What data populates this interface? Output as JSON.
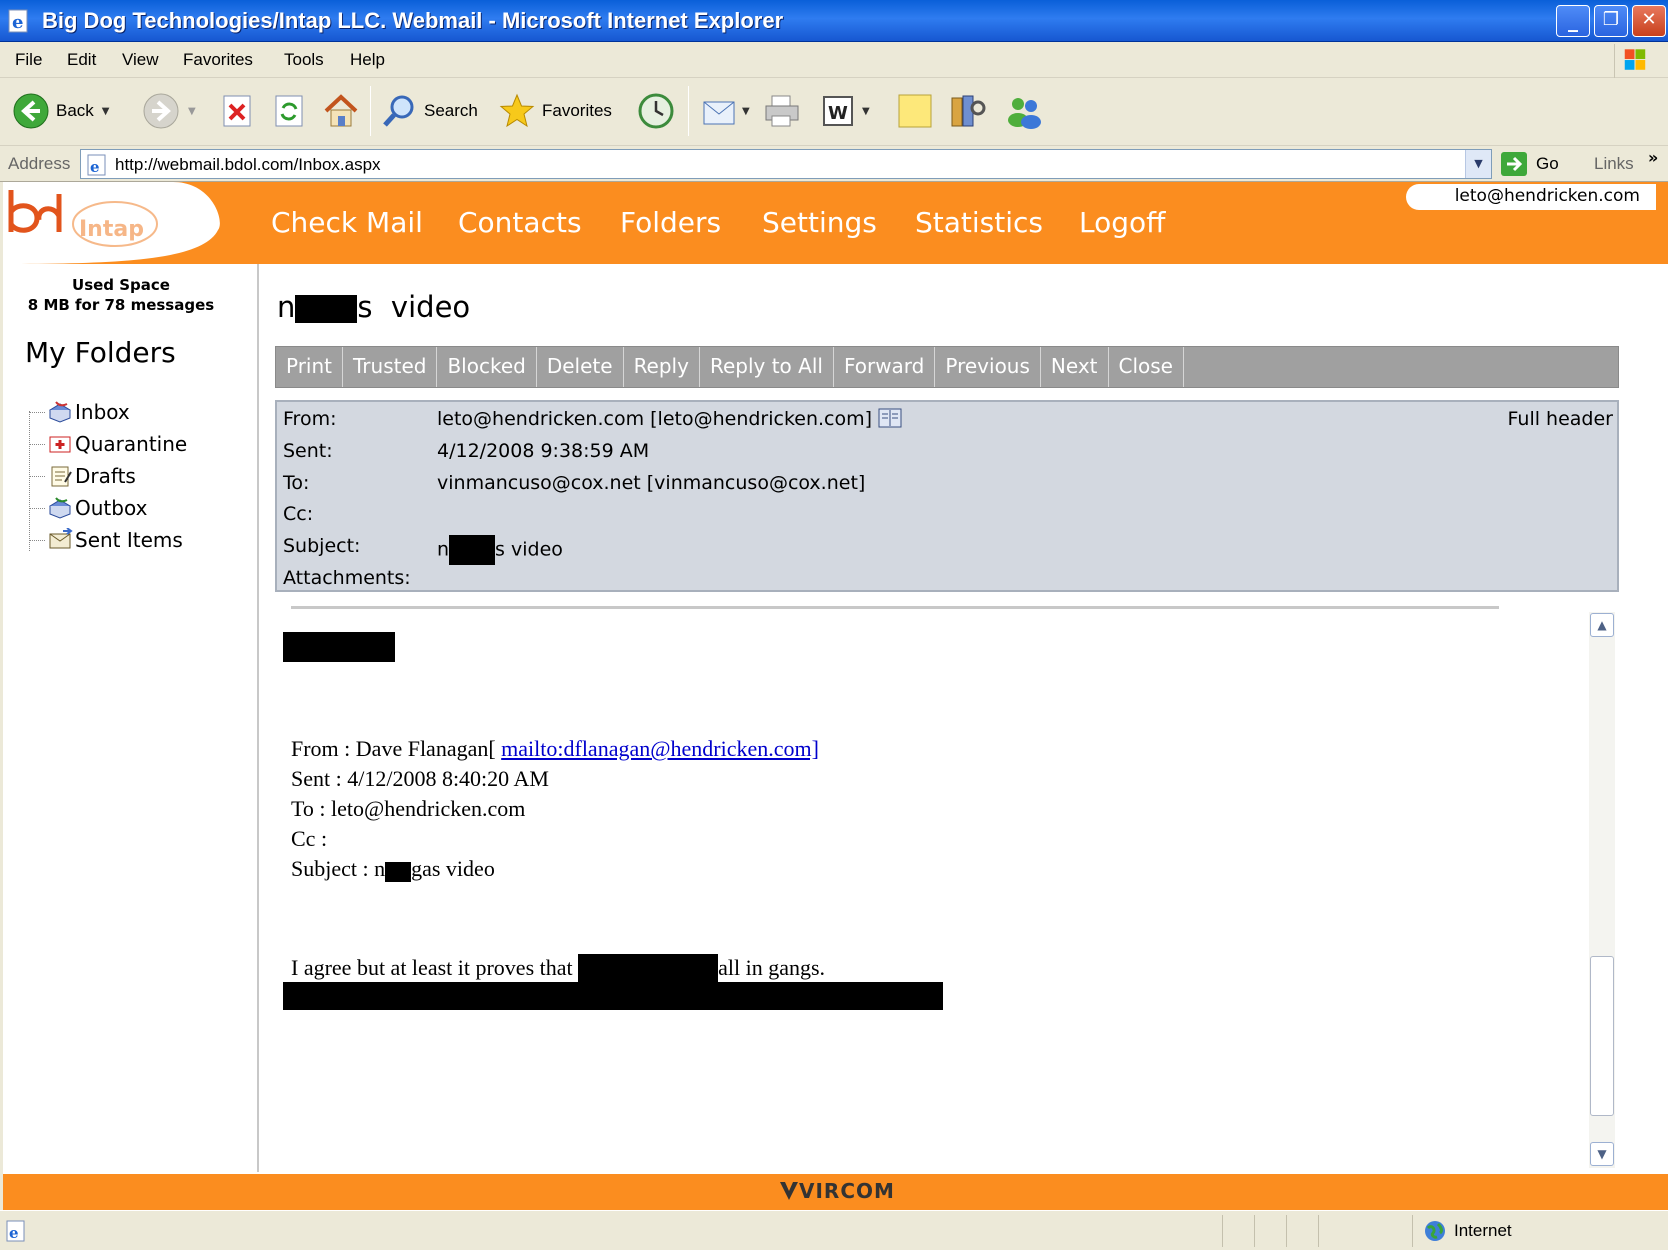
{
  "window": {
    "title": "Big Dog Technologies/Intap LLC. Webmail - Microsoft Internet Explorer",
    "controls": {
      "minimize": "_",
      "restore": "❐",
      "close": "✕"
    }
  },
  "menu": [
    "File",
    "Edit",
    "View",
    "Favorites",
    "Tools",
    "Help"
  ],
  "toolbar": {
    "back": "Back",
    "search": "Search",
    "favorites": "Favorites"
  },
  "address": {
    "label": "Address",
    "url": "http://webmail.bdol.com/Inbox.aspx",
    "go": "Go",
    "links": "Links",
    "links_chevron": "»"
  },
  "webmail": {
    "user": "leto@hendricken.com",
    "nav": [
      "Check Mail",
      "Contacts",
      "Folders",
      "Settings",
      "Statistics",
      "Logoff"
    ],
    "used_space_title": "Used Space",
    "used_space_detail": "8 MB for 78 messages",
    "my_folders": "My Folders",
    "folders": [
      "Inbox",
      "Quarantine",
      "Drafts",
      "Outbox",
      "Sent Items"
    ],
    "footer_brand": "VIRCOM"
  },
  "message": {
    "subject_prefix": "n",
    "subject_suffix": "s  video",
    "actions": [
      "Print",
      "Trusted",
      "Blocked",
      "Delete",
      "Reply",
      "Reply to All",
      "Forward",
      "Previous",
      "Next",
      "Close"
    ],
    "header": {
      "labels": [
        "From:",
        "Sent:",
        "To:",
        "Cc:",
        "Subject:",
        "Attachments:"
      ],
      "from": "leto@hendricken.com [leto@hendricken.com]",
      "sent": "4/12/2008 9:38:59 AM",
      "to": "vinmancuso@cox.net [vinmancuso@cox.net]",
      "cc": "",
      "subject_prefix": "n",
      "subject_suffix": "s video",
      "attachments": "",
      "full_header": "Full header"
    },
    "body": {
      "fwd_from_label": "From : Dave Flanagan[ ",
      "fwd_from_link": "mailto:dflanagan@hendricken.com]",
      "fwd_sent": "Sent : 4/12/2008 8:40:20 AM",
      "fwd_to": "To : leto@hendricken.com",
      "fwd_cc": "Cc :",
      "fwd_subject_prefix": "Subject : n",
      "fwd_subject_suffix": "gas video",
      "line_prefix": "I agree but at least it proves that ",
      "line_suffix": "all in gangs."
    }
  },
  "status": {
    "zone": "Internet"
  },
  "colors": {
    "brand_orange": "#fb8d1f",
    "header_panel": "#d3d8e0",
    "action_bar": "#a0a0a0",
    "link": "#0000cc"
  }
}
